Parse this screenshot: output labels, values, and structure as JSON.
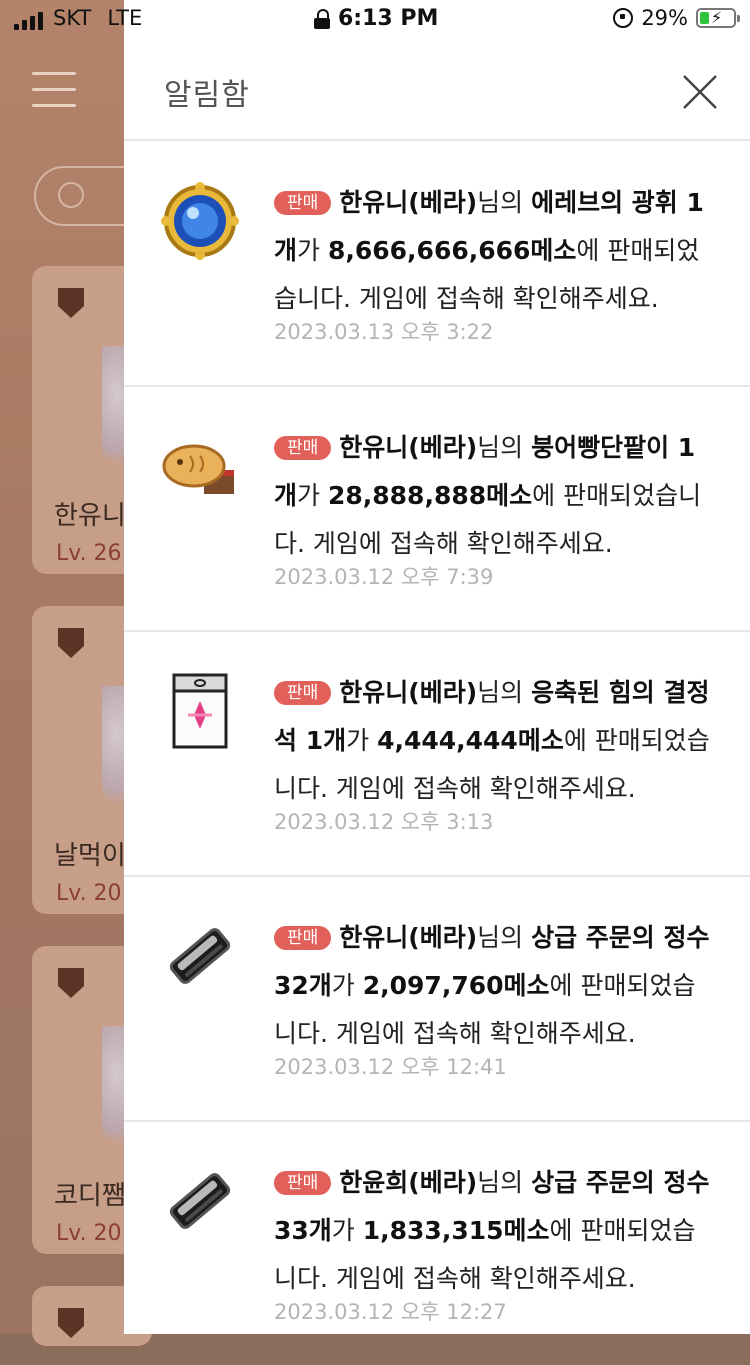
{
  "status_bar": {
    "carrier": "SKT",
    "network": "LTE",
    "time": "6:13 PM",
    "battery_percent": "29%",
    "battery_level": 0.29,
    "icons": [
      "signal-icon",
      "lock-icon",
      "rotation-lock-icon",
      "battery-charging-icon"
    ]
  },
  "background": {
    "cards": [
      {
        "name": "한유니",
        "level": "Lv. 26"
      },
      {
        "name": "날먹이",
        "level": "Lv. 20"
      },
      {
        "name": "코디쨈",
        "level": "Lv. 20"
      }
    ]
  },
  "drawer": {
    "title": "알림함",
    "close_icon": "close-icon",
    "badge_label": "판매",
    "notifications": [
      {
        "icon": "blue-gem-item-icon",
        "seller": "한유니(베라)",
        "seller_suffix": "님의 ",
        "item": "에레브의 광휘 1개",
        "mid": "가 ",
        "price": "8,666,666,666메소",
        "tail": "에 판매되었습니다. 게임에 접속해 확인해주세요.",
        "time": "2023.03.13 오후 3:22"
      },
      {
        "icon": "fish-bread-item-icon",
        "seller": "한유니(베라)",
        "seller_suffix": "님의 ",
        "item": "붕어빵단팥이 1개",
        "mid": "가 ",
        "price": "28,888,888메소",
        "tail": "에 판매되었습니다. 게임에 접속해 확인해주세요.",
        "time": "2023.03.12 오후 7:39"
      },
      {
        "icon": "crystal-card-item-icon",
        "seller": "한유니(베라)",
        "seller_suffix": "님의 ",
        "item": "응축된 힘의 결정석 1개",
        "mid": "가 ",
        "price": "4,444,444메소",
        "tail": "에 판매되었습니다. 게임에 접속해 확인해주세요.",
        "time": "2023.03.12 오후 3:13"
      },
      {
        "icon": "black-scroll-item-icon",
        "seller": "한유니(베라)",
        "seller_suffix": "님의 ",
        "item": "상급 주문의 정수 32개",
        "mid": "가 ",
        "price": "2,097,760메소",
        "tail": "에 판매되었습니다. 게임에 접속해 확인해주세요.",
        "time": "2023.03.12 오후 12:41"
      },
      {
        "icon": "black-scroll-item-icon",
        "seller": "한윤희(베라)",
        "seller_suffix": "님의 ",
        "item": "상급 주문의 정수 33개",
        "mid": "가 ",
        "price": "1,833,315메소",
        "tail": "에 판매되었습니다. 게임에 접속해 확인해주세요.",
        "time": "2023.03.12 오후 12:27"
      }
    ]
  },
  "colors": {
    "badge": "#e2605a",
    "timestamp": "#b4b4b4",
    "overlay_bg": "#a77a63"
  }
}
